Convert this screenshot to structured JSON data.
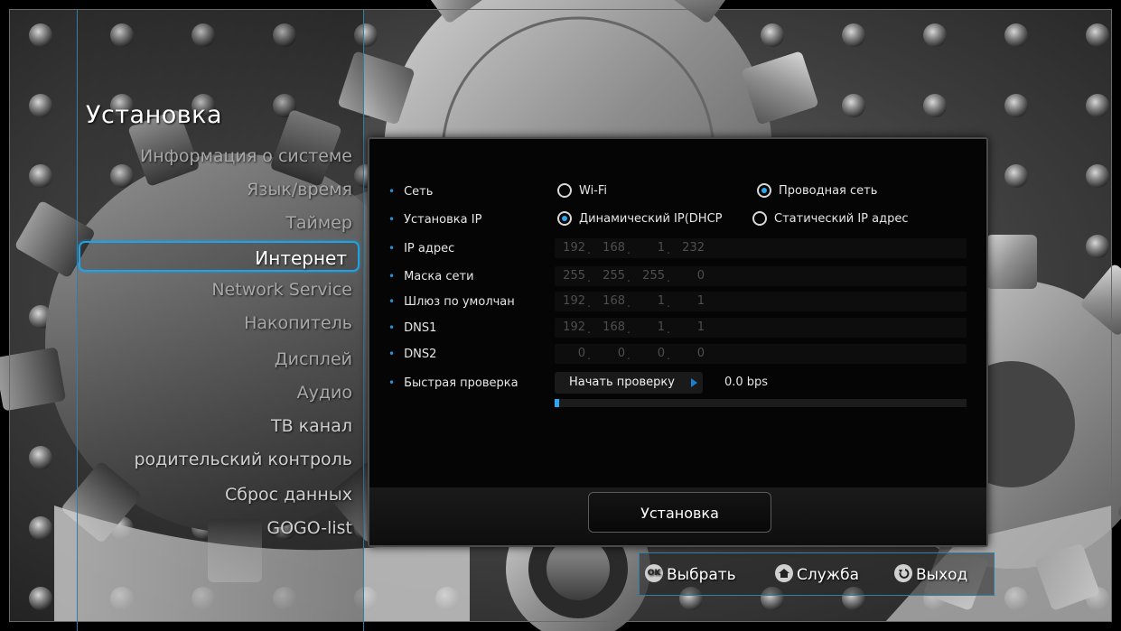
{
  "sidebar": {
    "title": "Установка",
    "items": [
      {
        "label": "Информация о системе",
        "dim": true
      },
      {
        "label": "Язык/время",
        "dim": true
      },
      {
        "label": "Таймер",
        "dim": true
      },
      {
        "label": "Интернет",
        "selected": true
      },
      {
        "label": "Network Service",
        "dim": true
      },
      {
        "label": "Накопитель",
        "dim": true
      },
      {
        "label": "Дисплей",
        "dim": true
      },
      {
        "label": "Аудио",
        "dim": true
      },
      {
        "label": "ТВ канал",
        "dim": false
      },
      {
        "label": "родительский контроль",
        "dim": false
      },
      {
        "label": "Сброс данных",
        "dim": false
      },
      {
        "label": "GOGO-list",
        "dim": false
      }
    ]
  },
  "form": {
    "network": {
      "label": "Сеть",
      "options": [
        "Wi-Fi",
        "Проводная сеть"
      ],
      "selected": "Проводная сеть"
    },
    "ip_setup": {
      "label": "Установка IP",
      "options": [
        "Динамический IP(DHCP",
        "Статический IP адрес"
      ],
      "selected": "Динамический IP(DHCP"
    },
    "ip_address": {
      "label": "IP адрес",
      "octets": [
        "192",
        "168",
        "1",
        "232"
      ]
    },
    "subnet_mask": {
      "label": "Маска сети",
      "octets": [
        "255",
        "255",
        "255",
        "0"
      ]
    },
    "gateway": {
      "label": "Шлюз по умолчан",
      "octets": [
        "192",
        "168",
        "1",
        "1"
      ]
    },
    "dns1": {
      "label": "DNS1",
      "octets": [
        "192",
        "168",
        "1",
        "1"
      ]
    },
    "dns2": {
      "label": "DNS2",
      "octets": [
        "0",
        "0",
        "0",
        "0"
      ]
    },
    "speed_test": {
      "label": "Быстрая проверка",
      "button": "Начать проверку",
      "speed": "0.0 bps",
      "progress": 0.01
    }
  },
  "setup_button": "Установка",
  "hints": {
    "ok_key": "OK",
    "select": "Выбрать",
    "service": "Служба",
    "exit": "Выход"
  },
  "colors": {
    "accent": "#2aa8f2",
    "border": "#2f7fa8",
    "panel": "#050505"
  }
}
